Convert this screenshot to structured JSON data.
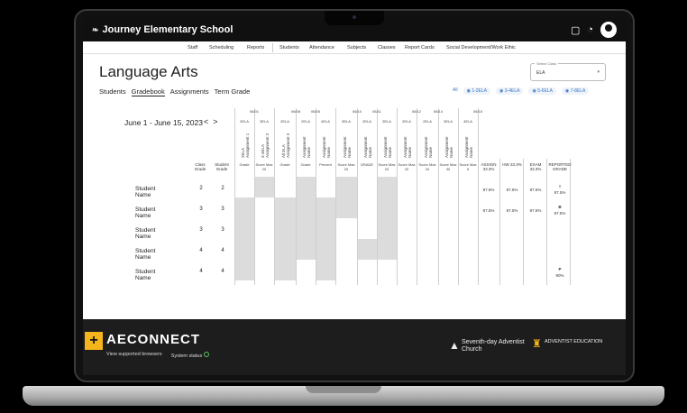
{
  "app": {
    "brand": "Journey Elementary School",
    "nav": [
      "Staff",
      "Scheduling",
      "Reports",
      "Students",
      "Attendance",
      "Subjects",
      "Classes",
      "Report Cards",
      "Social Development/Work Ethic"
    ]
  },
  "page": {
    "title": "Language Arts",
    "tabs": [
      "Students",
      "Gradebook",
      "Assignments",
      "Term Grade"
    ],
    "active_tab": "Gradebook",
    "select_class": {
      "label": "Select Class",
      "value": "ELA"
    },
    "filters": [
      "All",
      "1-2ELA",
      "3-4ELA",
      "5-6ELA",
      "7-8ELA"
    ],
    "date_range": "June 1 - June 15, 2023"
  },
  "gradebook": {
    "headers": {
      "class_grade": "Class Grade",
      "student_grade": "Student Grade",
      "assign": "ASSIGN 33.3%",
      "hw": "HW 33.3%",
      "exam": "EXAM 33.3%",
      "reported": "REPORTED GRADE"
    },
    "columns": [
      {
        "date": "06/01",
        "cls": "2ELA",
        "name": "2ELA Assignment 1",
        "sub": "Grade"
      },
      {
        "date": "",
        "cls": "3ELA",
        "name": "3-4ELA Assignment 2",
        "sub": "Score Max 20"
      },
      {
        "date": "06/08",
        "cls": "2ELA",
        "name": "All ELA Assignment 3",
        "sub": "Grade"
      },
      {
        "date": "06/05",
        "cls": "2ELA",
        "name": "Assignment Name",
        "sub": "Grade"
      },
      {
        "date": "",
        "cls": "4ELA",
        "name": "Assignment Name",
        "sub": "Percent"
      },
      {
        "date": "06/10",
        "cls": "3ELA",
        "name": "Assignment Name",
        "sub": "Score Max 20"
      },
      {
        "date": "06/11",
        "cls": "2ELA",
        "name": "Assignment Name",
        "sub": "GRADE"
      },
      {
        "date": "",
        "cls": "3ELA",
        "name": "Assignment Name",
        "sub": "Score Max 20"
      },
      {
        "date": "06/12",
        "cls": "2ELA",
        "name": "Assignment Name",
        "sub": "Score Max 20"
      },
      {
        "date": "06/14",
        "cls": "2ELA",
        "name": "Assignment Name",
        "sub": "Score Max 20"
      },
      {
        "date": "",
        "cls": "3ELA",
        "name": "Assignment Name",
        "sub": "Score Max 30"
      },
      {
        "date": "06/15",
        "cls": "4ELA",
        "name": "Assignment Name",
        "sub": "Score Max 5"
      }
    ],
    "rows": [
      {
        "name": "Student Name",
        "class_grade": "2",
        "student_grade": "2",
        "assign": "87.5%",
        "hw": "87.5%",
        "exam": "87.5%",
        "reported_letter": "I",
        "reported_pct": "87.5%"
      },
      {
        "name": "Student Name",
        "class_grade": "3",
        "student_grade": "3",
        "assign": "87.5%",
        "hw": "87.5%",
        "exam": "87.5%",
        "reported_letter": "B",
        "reported_pct": "87.5%"
      },
      {
        "name": "Student Name",
        "class_grade": "3",
        "student_grade": "3",
        "assign": "",
        "hw": "",
        "exam": "",
        "reported_letter": "",
        "reported_pct": ""
      },
      {
        "name": "Student Name",
        "class_grade": "4",
        "student_grade": "4",
        "assign": "",
        "hw": "",
        "exam": "",
        "reported_letter": "",
        "reported_pct": ""
      },
      {
        "name": "Student Name",
        "class_grade": "4",
        "student_grade": "4",
        "assign": "",
        "hw": "",
        "exam": "",
        "reported_letter": "P",
        "reported_pct": "90%"
      }
    ]
  },
  "footer": {
    "logo": "AECONNECT",
    "links": [
      "View supported browsers",
      "System status"
    ],
    "sda": "Seventh-day Adventist Church",
    "adv": "ADVENTIST EDUCATION"
  },
  "colors": {
    "accent": "#f4b51c",
    "dark": "#101010",
    "link": "#3a79c7",
    "shade": "#dcdcdc"
  }
}
